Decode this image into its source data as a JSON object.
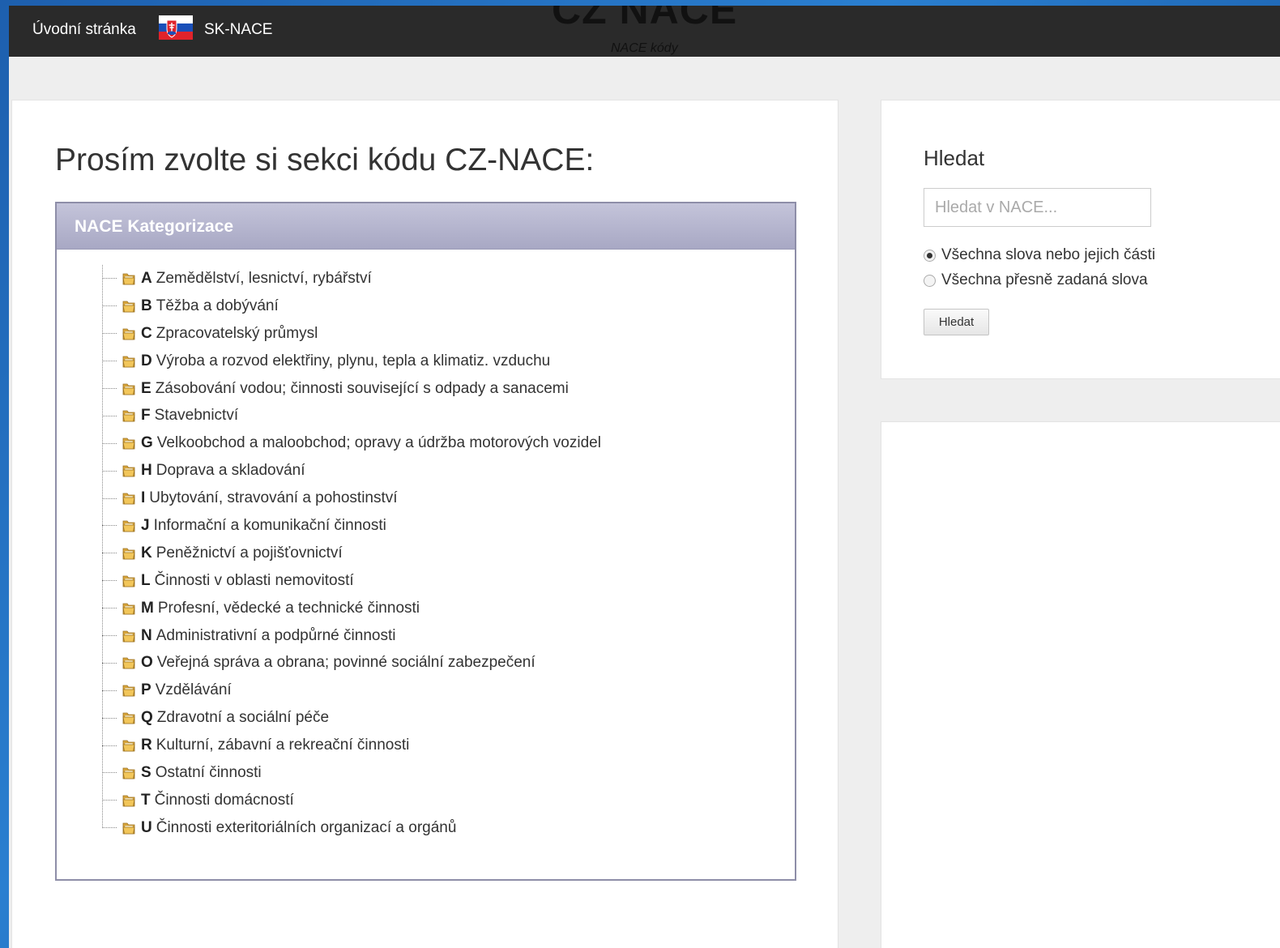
{
  "nav": {
    "home_label": "Úvodní stránka",
    "sk_label": "SK-NACE",
    "brand_title": "CZ NACE",
    "brand_subtitle": "NACE kódy"
  },
  "main": {
    "title": "Prosím zvolte si sekci kódu CZ-NACE:",
    "box_header": "NACE Kategorizace",
    "categories": [
      {
        "code": "A",
        "label": "Zemědělství, lesnictví, rybářství"
      },
      {
        "code": "B",
        "label": "Těžba a dobývání"
      },
      {
        "code": "C",
        "label": "Zpracovatelský průmysl"
      },
      {
        "code": "D",
        "label": "Výroba a rozvod elektřiny, plynu, tepla a klimatiz. vzduchu"
      },
      {
        "code": "E",
        "label": "Zásobování vodou; činnosti související s odpady a sanacemi"
      },
      {
        "code": "F",
        "label": "Stavebnictví"
      },
      {
        "code": "G",
        "label": "Velkoobchod a maloobchod; opravy a údržba motorových vozidel"
      },
      {
        "code": "H",
        "label": "Doprava a skladování"
      },
      {
        "code": "I",
        "label": "Ubytování, stravování a pohostinství"
      },
      {
        "code": "J",
        "label": "Informační a komunikační činnosti"
      },
      {
        "code": "K",
        "label": "Peněžnictví a pojišťovnictví"
      },
      {
        "code": "L",
        "label": "Činnosti v oblasti nemovitostí"
      },
      {
        "code": "M",
        "label": "Profesní, vědecké a technické činnosti"
      },
      {
        "code": "N",
        "label": "Administrativní a podpůrné činnosti"
      },
      {
        "code": "O",
        "label": "Veřejná správa a obrana; povinné sociální zabezpečení"
      },
      {
        "code": "P",
        "label": "Vzdělávání"
      },
      {
        "code": "Q",
        "label": "Zdravotní a sociální péče"
      },
      {
        "code": "R",
        "label": "Kulturní, zábavní a rekreační činnosti"
      },
      {
        "code": "S",
        "label": "Ostatní činnosti"
      },
      {
        "code": "T",
        "label": "Činnosti domácností"
      },
      {
        "code": "U",
        "label": "Činnosti exteritoriálních organizací a orgánů"
      }
    ]
  },
  "search": {
    "title": "Hledat",
    "placeholder": "Hledat v NACE...",
    "value": "",
    "option_all_parts": "Všechna slova nebo jejich části",
    "option_exact": "Všechna přesně zadaná slova",
    "selected_option": "all_parts",
    "button_label": "Hledat"
  },
  "colors": {
    "topbar": "#2a2a2a",
    "box_header": "#b4b4ce"
  },
  "icons": {
    "category": "folder-icon",
    "sk": "slovak-flag-icon"
  }
}
